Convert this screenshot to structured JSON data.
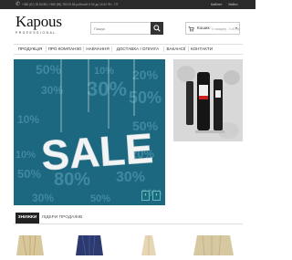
{
  "topbar": {
    "phones": "+380 (67) 35 83 88 | +380 (95) 783 00 56 робочий: 9 00 до 18 00 ПН - ПТ",
    "account": "Кабінет",
    "login": "Увійти"
  },
  "logo": {
    "brand": "Kapous",
    "tagline": "PROFESSIONAL"
  },
  "search": {
    "placeholder": "Пошук"
  },
  "cart": {
    "label": "Кошик:",
    "value": "0 товар(ів) - 0.00 грн"
  },
  "nav": {
    "items": [
      {
        "label": "ПРОДУКЦІЯ"
      },
      {
        "label": "ПРО КОМПАНІЮ"
      },
      {
        "label": "НАВЧАННЯ"
      },
      {
        "label": "ДОСТАВКА І ОПЛАТА"
      },
      {
        "label": "ВАКАНСІЇ"
      },
      {
        "label": "КОНТАКТИ"
      }
    ]
  },
  "banner": {
    "headline": "SALE",
    "badges": [
      "50%",
      "30%",
      "10%",
      "20%",
      "30%",
      "50%",
      "10%",
      "50%",
      "20%",
      "10%",
      "30%",
      "80%",
      "50%",
      "50%",
      "30%",
      "20%"
    ],
    "prev": "‹",
    "next": "›"
  },
  "tabs": [
    {
      "label": "ЗНИЖКИ",
      "active": true
    },
    {
      "label": "ЛІДЕРИ ПРОДАЖІВ",
      "active": false
    }
  ],
  "colors": {
    "banner_bg": "#1c6880",
    "nav_border": "#e0e0e0",
    "topbar_bg": "#2a2a2a",
    "tab_active_bg": "#222222"
  },
  "icons": [
    "phone-icon",
    "search-icon",
    "cart-icon",
    "chevron-down-icon",
    "chevron-left-icon",
    "chevron-right-icon"
  ]
}
